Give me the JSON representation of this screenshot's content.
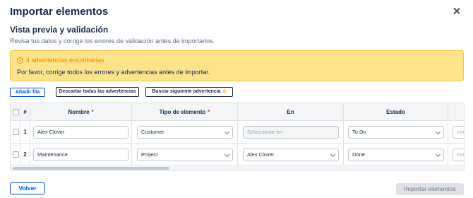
{
  "dialog": {
    "title": "Importar elementos",
    "subtitle": "Vista previa y validación",
    "description": "Revisa tus datos y corrige los errores de validación antes de importarlos."
  },
  "alert": {
    "title": "4 advertencias encontradas",
    "message": "Por favor, corrige todos los errores y advertencias antes de importar.",
    "icon": "warning-circle-icon",
    "color": "#ffe38a"
  },
  "toolbar": {
    "add_row": "Añadir fila",
    "discard_warnings": "Descartar todas las advertencias",
    "find_next_warning": "Buscar siguiente advertencia",
    "warning_glyph": "⚠"
  },
  "table": {
    "columns": {
      "num": "#",
      "name": "Nombre",
      "type": "Tipo de elemento",
      "in": "En",
      "state": "Estado",
      "required_mark": "*"
    },
    "rows": [
      {
        "num": "1",
        "name": "Alex Clover",
        "type": "Customer",
        "in": "Seleccionar en",
        "state": "To Do",
        "extra": "Intro"
      },
      {
        "num": "2",
        "name": "Maintenance",
        "type": "Project",
        "in": "Alex Clover",
        "state": "Done",
        "extra": "Intro"
      }
    ]
  },
  "footer": {
    "back": "Volver",
    "import": "Importar elementos"
  },
  "colors": {
    "accent": "#0052cc",
    "warning": "#e38b00",
    "required": "#de350b"
  }
}
